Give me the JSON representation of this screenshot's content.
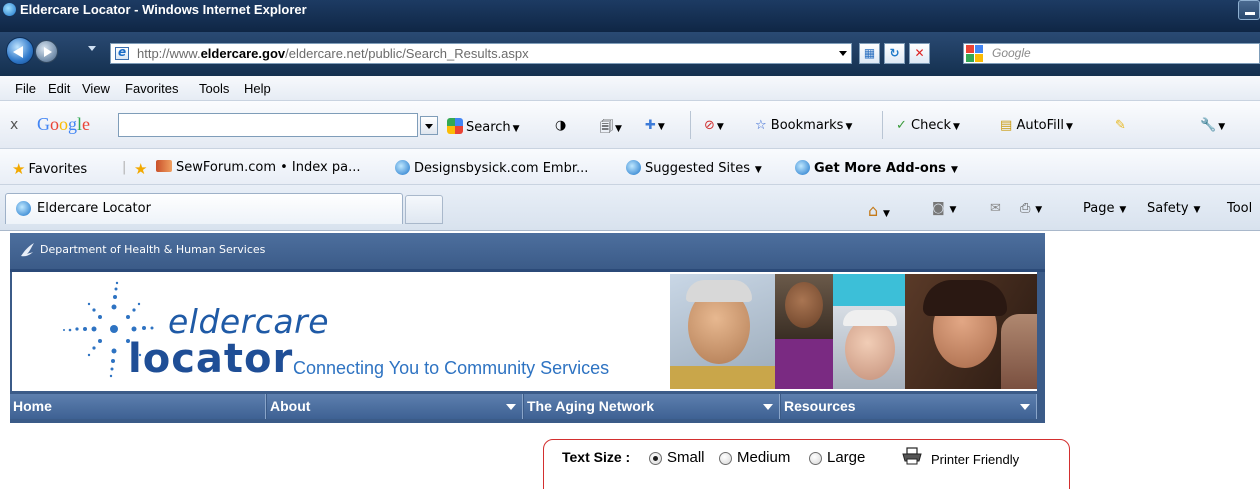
{
  "window": {
    "title": "Eldercare Locator - Windows Internet Explorer"
  },
  "address": {
    "url_prefix": "http://www.",
    "url_domain": "eldercare.gov",
    "url_path": "/eldercare.net/public/Search_Results.aspx",
    "search_placeholder": "Google"
  },
  "menu": {
    "items": [
      "File",
      "Edit",
      "View",
      "Favorites",
      "Tools",
      "Help"
    ]
  },
  "google_toolbar": {
    "close": "x",
    "brand": "Google",
    "search_value": "",
    "search_label": "Search",
    "bookmarks_label": "Bookmarks",
    "check_label": "Check",
    "autofill_label": "AutoFill"
  },
  "favorites": {
    "favorites_label": "Favorites",
    "items": [
      "SewForum.com • Index pa...",
      "Designsbysick.com Embr...",
      "Suggested Sites",
      "Get More Add-ons"
    ]
  },
  "tabs": {
    "active_label": "Eldercare Locator"
  },
  "command_bar": {
    "page_label": "Page",
    "safety_label": "Safety",
    "tools_label": "Tool"
  },
  "site": {
    "hhs_text": "Department of Health & Human Services",
    "logo_top": "eldercare",
    "logo_bottom": "locator",
    "tagline": "Connecting You to Community Services",
    "nav": [
      "Home",
      "About",
      "The Aging Network",
      "Resources"
    ]
  },
  "text_size": {
    "label": "Text Size :",
    "options": [
      "Small",
      "Medium",
      "Large"
    ],
    "selected": "Small",
    "printer_label": "Printer Friendly"
  },
  "colors": {
    "nav_blue": "#3b5b88",
    "logo_blue": "#1f5aa6",
    "panel_border": "#d32f2f"
  }
}
